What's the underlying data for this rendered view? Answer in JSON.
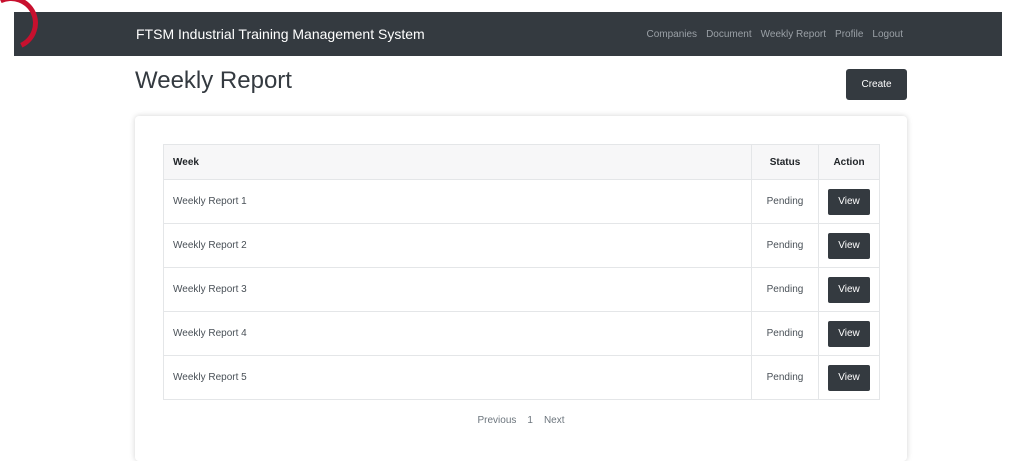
{
  "navbar": {
    "brand": "FTSM Industrial Training Management System",
    "links": [
      "Companies",
      "Document",
      "Weekly Report",
      "Profile",
      "Logout"
    ]
  },
  "page": {
    "title": "Weekly Report",
    "create_label": "Create"
  },
  "table": {
    "headers": {
      "week": "Week",
      "status": "Status",
      "action": "Action"
    },
    "rows": [
      {
        "week": "Weekly Report 1",
        "status": "Pending",
        "action": "View"
      },
      {
        "week": "Weekly Report 2",
        "status": "Pending",
        "action": "View"
      },
      {
        "week": "Weekly Report 3",
        "status": "Pending",
        "action": "View"
      },
      {
        "week": "Weekly Report 4",
        "status": "Pending",
        "action": "View"
      },
      {
        "week": "Weekly Report 5",
        "status": "Pending",
        "action": "View"
      }
    ]
  },
  "pagination": {
    "previous": "Previous",
    "current": "1",
    "next": "Next"
  },
  "colors": {
    "navbar_bg": "#343a40",
    "button_bg": "#343a40",
    "accent_mark": "#c8102e"
  }
}
